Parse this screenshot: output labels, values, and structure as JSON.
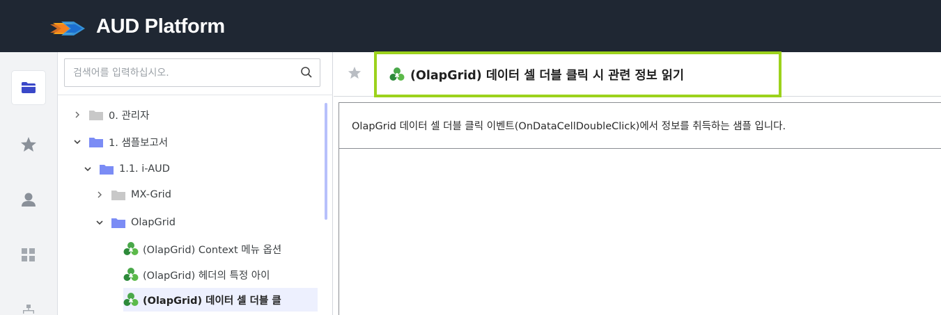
{
  "header": {
    "brand": "AUD Platform",
    "logo_icon": "aud-logo-icon",
    "background_color": "#1f2733"
  },
  "rail": {
    "items": [
      {
        "name": "folder-icon",
        "active": true
      },
      {
        "name": "star-icon",
        "active": false
      },
      {
        "name": "user-icon",
        "active": false
      },
      {
        "name": "grid-icon",
        "active": false
      },
      {
        "name": "org-chart-icon",
        "active": false
      }
    ],
    "accent_color": "#3a48c8"
  },
  "tree": {
    "search": {
      "placeholder": "검색어를 입력하십시오.",
      "value": ""
    },
    "nodes": [
      {
        "label": "0. 관리자",
        "type": "folder",
        "expanded": false,
        "folder_color": "#c8c8c8"
      },
      {
        "label": "1. 샘플보고서",
        "type": "folder",
        "expanded": true,
        "folder_color": "#7b8cf5"
      },
      {
        "label": "1.1. i-AUD",
        "type": "folder",
        "expanded": true,
        "folder_color": "#7b8cf5"
      },
      {
        "label": "MX-Grid",
        "type": "folder",
        "expanded": false,
        "folder_color": "#c8c8c8"
      },
      {
        "label": "OlapGrid",
        "type": "folder",
        "expanded": true,
        "folder_color": "#7b8cf5"
      },
      {
        "label": "(OlapGrid) Context 메뉴 옵션",
        "type": "report",
        "selected": false
      },
      {
        "label": "(OlapGrid) 헤더의 특정 아이",
        "type": "report",
        "selected": false
      },
      {
        "label": "(OlapGrid) 데이터 셀 더블 클",
        "type": "report",
        "selected": true
      }
    ]
  },
  "main": {
    "favorite_icon": "star-icon",
    "title": "(OlapGrid) 데이터 셀 더블 클릭 시 관련 정보 읽기",
    "highlight_color": "#9cd21c",
    "description": "OlapGrid 데이터 셀 더블 클릭  이벤트(OnDataCellDoubleClick)에서 정보를 취득하는 샘플 입니다."
  }
}
